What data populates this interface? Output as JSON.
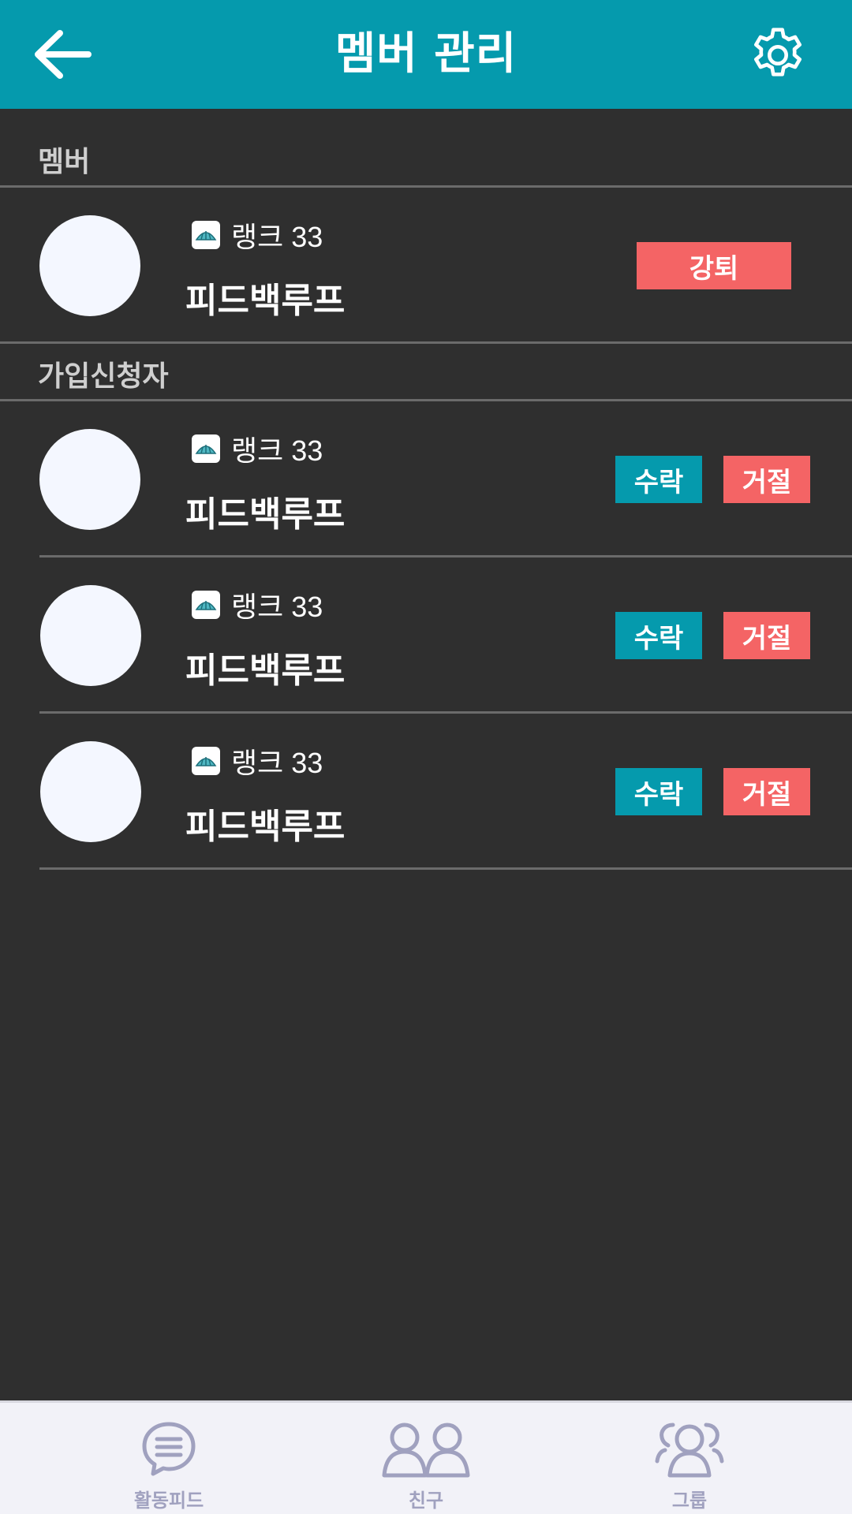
{
  "header": {
    "title": "멤버 관리",
    "back_icon": "arrow-left-icon",
    "settings_icon": "gear-icon"
  },
  "members_section": {
    "label": "멤버",
    "items": [
      {
        "rank": "랭크 33",
        "name": "피드백루프",
        "kick_label": "강퇴"
      }
    ]
  },
  "applicants_section": {
    "label": "가입신청자",
    "items": [
      {
        "rank": "랭크 33",
        "name": "피드백루프",
        "accept_label": "수락",
        "reject_label": "거절"
      },
      {
        "rank": "랭크 33",
        "name": "피드백루프",
        "accept_label": "수락",
        "reject_label": "거절"
      },
      {
        "rank": "랭크 33",
        "name": "피드백루프",
        "accept_label": "수락",
        "reject_label": "거절"
      }
    ]
  },
  "tabbar": {
    "items": [
      {
        "label": "활동피드",
        "icon": "chat-bubble-icon"
      },
      {
        "label": "친구",
        "icon": "friends-icon"
      },
      {
        "label": "그룹",
        "icon": "group-icon"
      }
    ]
  },
  "colors": {
    "accent": "#059aad",
    "danger": "#f46465",
    "background": "#2f2f2f",
    "tab_icon": "#a0a1bf"
  }
}
